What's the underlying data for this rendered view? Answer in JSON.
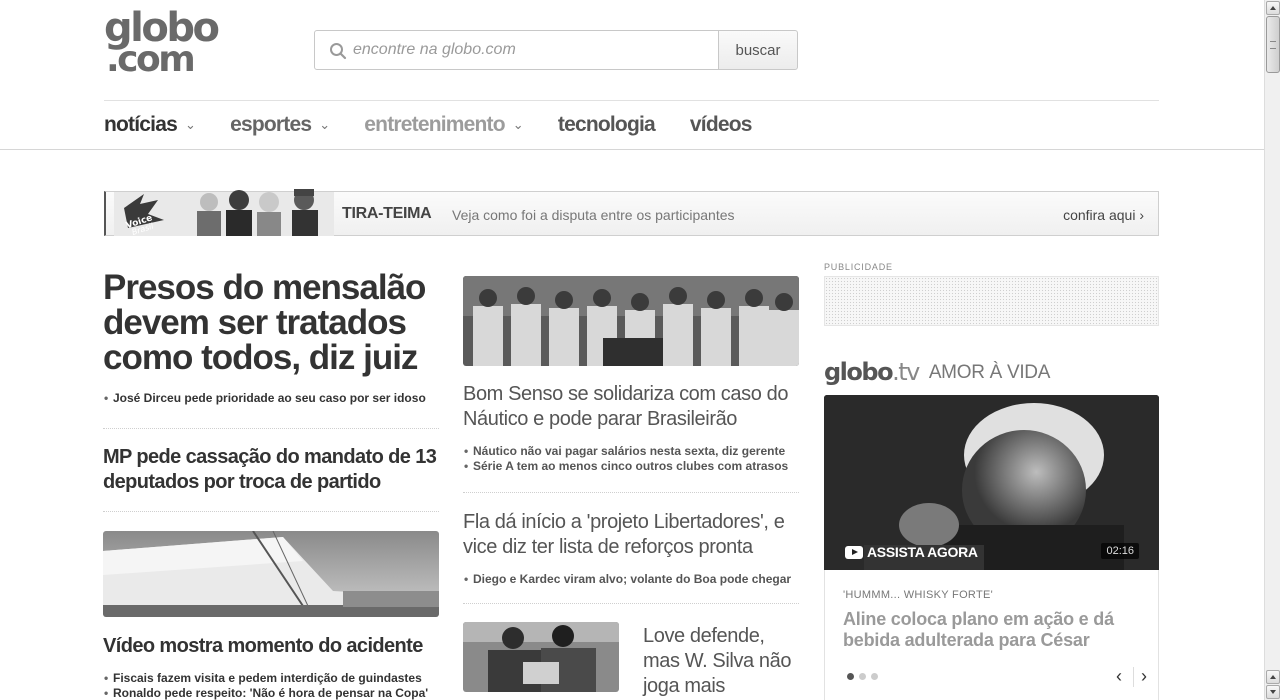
{
  "header": {
    "logo_line1": "globo",
    "logo_line2": ".com",
    "search_placeholder": "encontre na globo.com",
    "search_button": "buscar",
    "nav": [
      {
        "label": "notícias",
        "has_dropdown": true
      },
      {
        "label": "esportes",
        "has_dropdown": true
      },
      {
        "label": "entretenimento",
        "has_dropdown": true
      },
      {
        "label": "tecnologia",
        "has_dropdown": false
      },
      {
        "label": "vídeos",
        "has_dropdown": false
      }
    ],
    "chevron": "⌄"
  },
  "banner": {
    "title": "TIRA-TEIMA",
    "description": "Veja como foi a disputa entre os participantes",
    "cta": "confira aqui ›"
  },
  "left_column": {
    "headline": "Presos do mensalão devem ser tratados como todos, diz juiz",
    "headline_bullets": [
      "José Dirceu pede prioridade ao seu caso por ser idoso"
    ],
    "story2": "MP pede cassação do mandato de 13 deputados por troca de partido",
    "story3": "Vídeo mostra momento do acidente",
    "story3_bullets": [
      "Fiscais fazem visita e pedem interdição de guindastes",
      "Ronaldo pede respeito: 'Não é hora de pensar na Copa'"
    ]
  },
  "middle_column": {
    "story1": "Bom Senso se solidariza com caso do Náutico e pode parar Brasileirão",
    "story1_bullets": [
      "Náutico não vai pagar salários nesta sexta, diz gerente",
      "Série A tem ao menos cinco outros clubes com atrasos"
    ],
    "story2": "Fla dá início a 'projeto Libertadores', e vice diz ter lista de reforços pronta",
    "story2_bullets": [
      "Diego e Kardec viram alvo; volante do Boa pode chegar"
    ],
    "story3": "Love defende, mas W. Silva não joga mais"
  },
  "right_column": {
    "ad_label": "PUBLICIDADE",
    "globotv_logo": "globo",
    "globotv_logo_suffix": ".tv",
    "show_name": "AMOR À VIDA",
    "watch_now": "ASSISTA AGORA",
    "duration": "02:16",
    "kicker": "'HUMMM... WHISKY FORTE'",
    "video_title": "Aline coloca plano em ação e dá bebida adulterada para César",
    "carousel_active_index": 0,
    "carousel_count": 3,
    "prev_icon": "‹",
    "next_icon": "›"
  }
}
